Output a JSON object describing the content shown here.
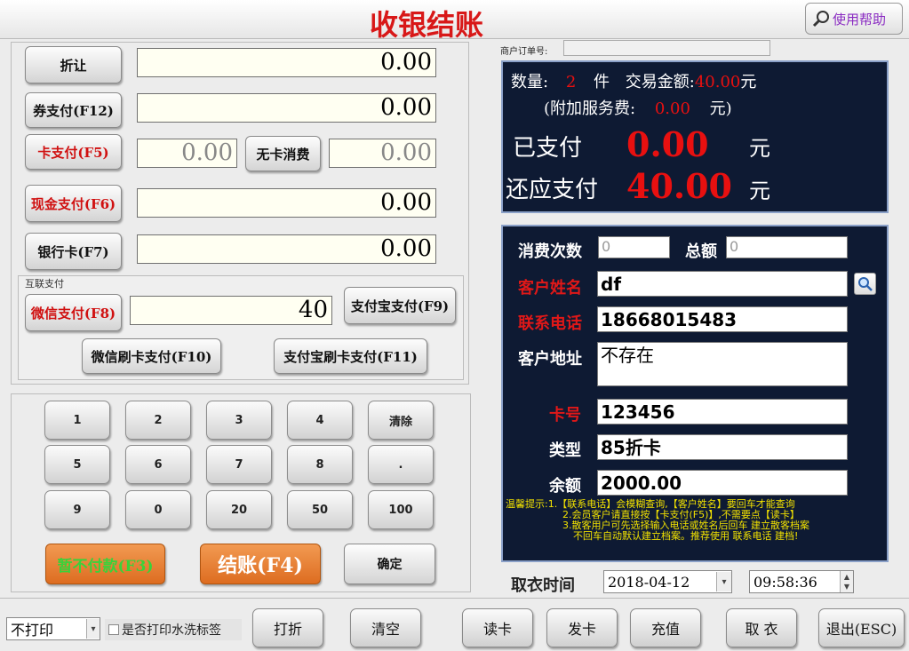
{
  "title": "收银结账",
  "help_label": "使用帮助",
  "payments": {
    "discount": {
      "label": "折让",
      "value": "0.00"
    },
    "coupon": {
      "label": "券支付(F12)",
      "value": "0.00"
    },
    "card": {
      "label": "卡支付(F5)",
      "value": "0.00",
      "nocard_label": "无卡消费",
      "nocard_value": "0.00"
    },
    "cash": {
      "label": "现金支付(F6)",
      "value": "0.00"
    },
    "bank": {
      "label": "银行卡(F7)",
      "value": "0.00"
    },
    "online_group": "互联支付",
    "wechat": {
      "label": "微信支付(F8)",
      "value": "40"
    },
    "alipay_label": "支付宝支付(F9)",
    "wechat_swipe_label": "微信刷卡支付(F10)",
    "alipay_swipe_label": "支付宝刷卡支付(F11)"
  },
  "keypad": [
    [
      "1",
      "2",
      "3",
      "4",
      "清除"
    ],
    [
      "5",
      "6",
      "7",
      "8",
      "."
    ],
    [
      "9",
      "0",
      "20",
      "50",
      "100"
    ]
  ],
  "actions": {
    "defer_label": "暂不付款(F3)",
    "checkout_label": "结账(F4)",
    "confirm_label": "确定"
  },
  "order": {
    "label": "商户订单号:",
    "value": ""
  },
  "summary": {
    "qty_label": "数量:",
    "qty": "2",
    "qty_unit": "件",
    "amount_label": "交易金额:",
    "amount": "40.00",
    "amount_unit": "元",
    "service_label": "(附加服务费:",
    "service": "0.00",
    "service_unit": "元)",
    "paid_label": "已支付",
    "paid": "0.00",
    "paid_unit": "元",
    "due_label": "还应支付",
    "due": "40.00",
    "due_unit": "元"
  },
  "customer": {
    "visits_label": "消费次数",
    "visits": "0",
    "total_label": "总额",
    "total": "0",
    "name_label": "客户姓名",
    "name": "df",
    "phone_label": "联系电话",
    "phone": "18668015483",
    "address_label": "客户地址",
    "address": "不存在",
    "card_label": "卡号",
    "card": "123456",
    "type_label": "类型",
    "type": "85折卡",
    "balance_label": "余额",
    "balance": "2000.00",
    "tips": [
      "温馨提示:1.【联系电话】会模糊查询,【客户姓名】要回车才能查询",
      "2.会员客户请直接按【卡支付(F5)】,不需要点【读卡】",
      "3.散客用户可先选择输入电话或姓名后回车 建立散客档案",
      "不回车自动默认建立档案。推荐使用 联系电话 建档!"
    ]
  },
  "pickup": {
    "label": "取衣时间",
    "date": "2018-04-12",
    "time": "09:58:36"
  },
  "print": {
    "select": "不打印",
    "checkbox_label": "是否打印水洗标签"
  },
  "bottom": [
    "打折",
    "清空",
    "读卡",
    "发卡",
    "充值",
    "取 衣",
    "退出(ESC)"
  ],
  "colors": {
    "title": "#d81818",
    "dark_bg": "#0e1a33",
    "red_amount": "#e81010",
    "orange": "#e8782a"
  }
}
